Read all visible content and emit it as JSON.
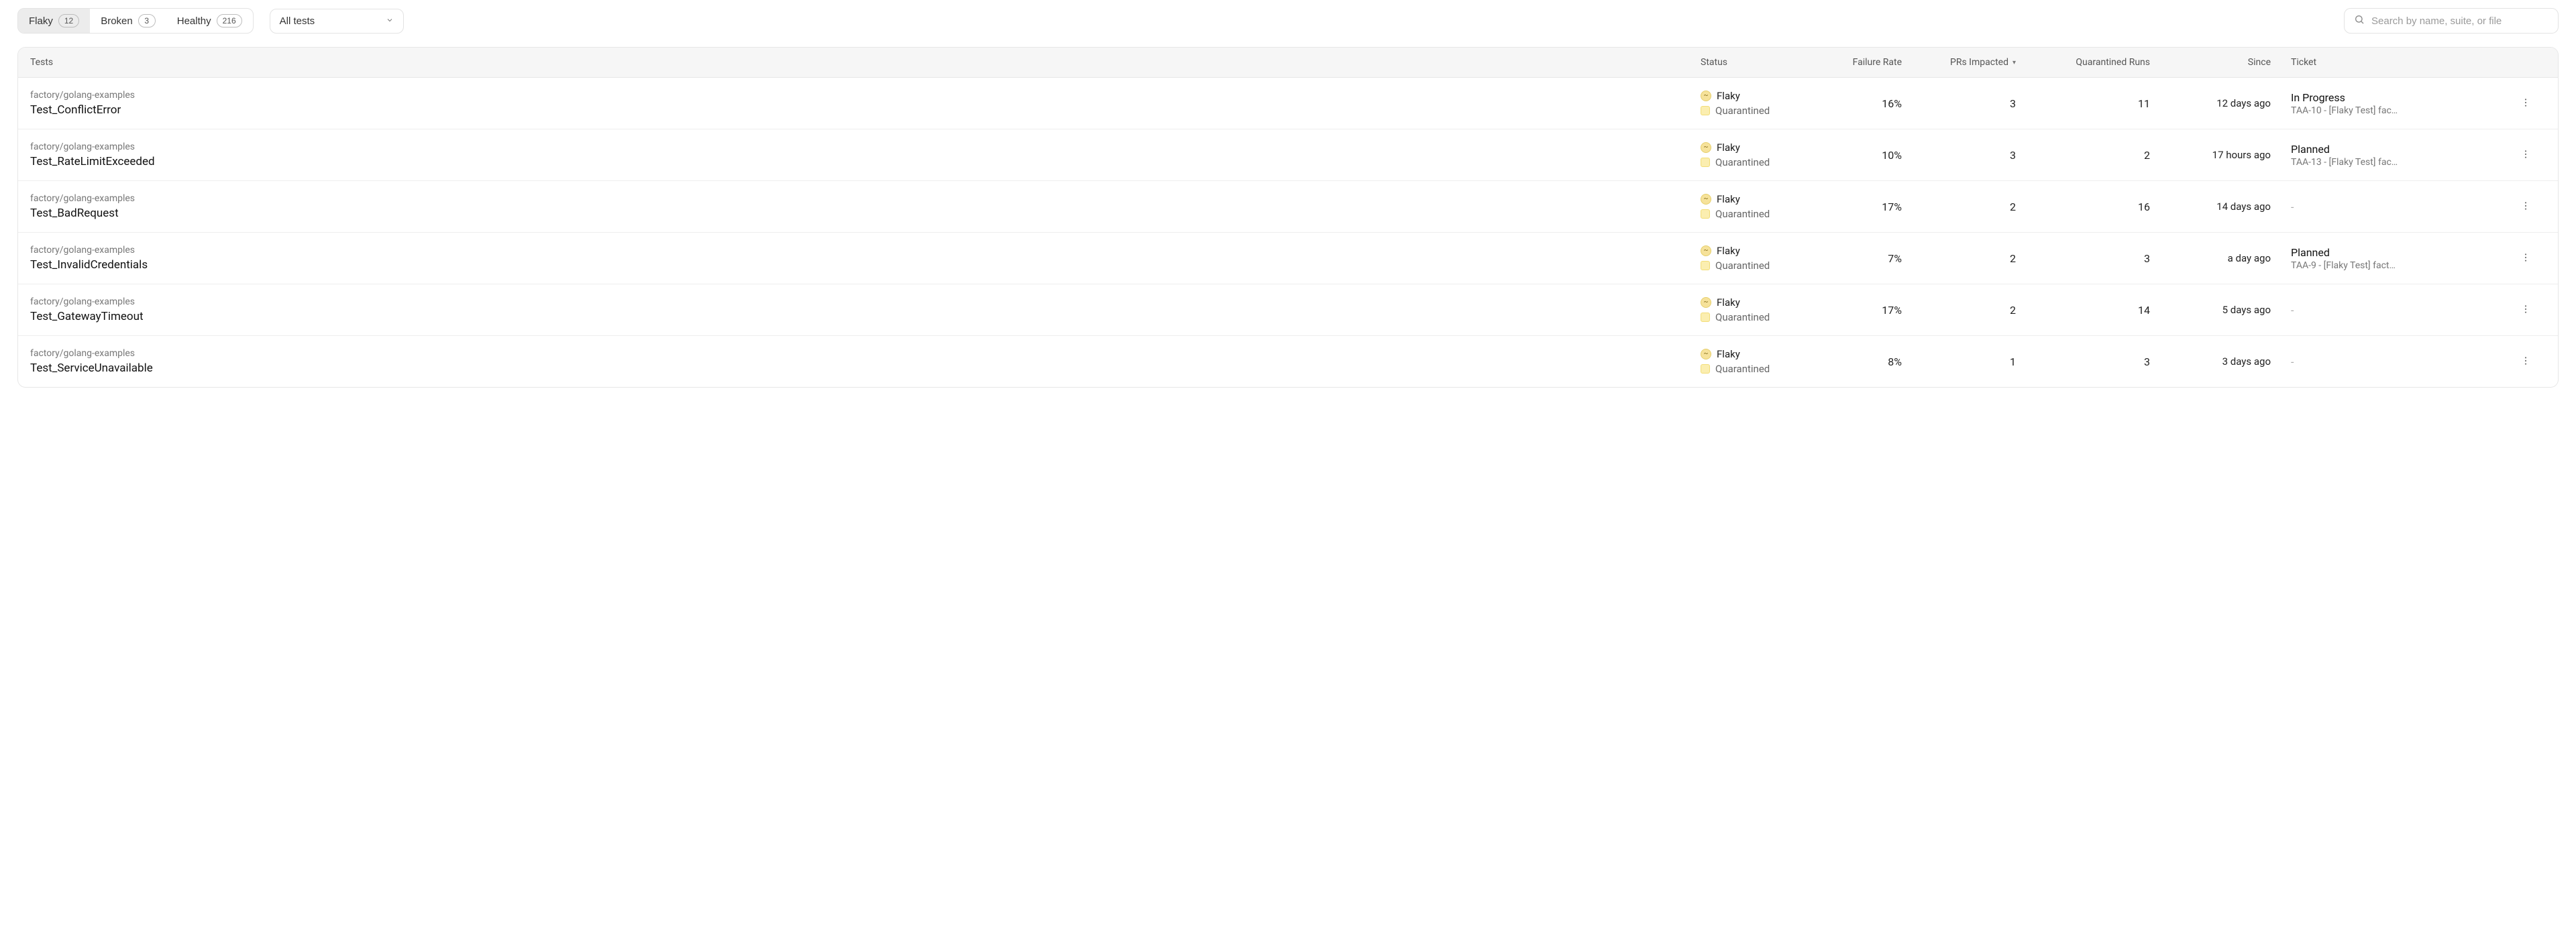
{
  "filters": {
    "tabs": [
      {
        "label": "Flaky",
        "count": "12",
        "active": true
      },
      {
        "label": "Broken",
        "count": "3",
        "active": false
      },
      {
        "label": "Healthy",
        "count": "216",
        "active": false
      }
    ],
    "scope_label": "All tests",
    "search_placeholder": "Search by name, suite, or file"
  },
  "columns": {
    "tests": "Tests",
    "status": "Status",
    "failure_rate": "Failure Rate",
    "prs_impacted": "PRs Impacted",
    "quarantined_runs": "Quarantined Runs",
    "since": "Since",
    "ticket": "Ticket"
  },
  "status_labels": {
    "flaky": "Flaky",
    "quarantined": "Quarantined"
  },
  "rows": [
    {
      "path": "factory/golang-examples",
      "name": "Test_ConflictError",
      "failure_rate": "16%",
      "prs_impacted": "3",
      "quarantined_runs": "11",
      "since": "12 days ago",
      "ticket_status": "In Progress",
      "ticket_sub": "TAA-10 - [Flaky Test] fac…"
    },
    {
      "path": "factory/golang-examples",
      "name": "Test_RateLimitExceeded",
      "failure_rate": "10%",
      "prs_impacted": "3",
      "quarantined_runs": "2",
      "since": "17 hours ago",
      "ticket_status": "Planned",
      "ticket_sub": "TAA-13 - [Flaky Test] fac…"
    },
    {
      "path": "factory/golang-examples",
      "name": "Test_BadRequest",
      "failure_rate": "17%",
      "prs_impacted": "2",
      "quarantined_runs": "16",
      "since": "14 days ago",
      "ticket_status": "-",
      "ticket_sub": ""
    },
    {
      "path": "factory/golang-examples",
      "name": "Test_InvalidCredentials",
      "failure_rate": "7%",
      "prs_impacted": "2",
      "quarantined_runs": "3",
      "since": "a day ago",
      "ticket_status": "Planned",
      "ticket_sub": "TAA-9 - [Flaky Test] fact…"
    },
    {
      "path": "factory/golang-examples",
      "name": "Test_GatewayTimeout",
      "failure_rate": "17%",
      "prs_impacted": "2",
      "quarantined_runs": "14",
      "since": "5 days ago",
      "ticket_status": "-",
      "ticket_sub": ""
    },
    {
      "path": "factory/golang-examples",
      "name": "Test_ServiceUnavailable",
      "failure_rate": "8%",
      "prs_impacted": "1",
      "quarantined_runs": "3",
      "since": "3 days ago",
      "ticket_status": "-",
      "ticket_sub": ""
    }
  ]
}
